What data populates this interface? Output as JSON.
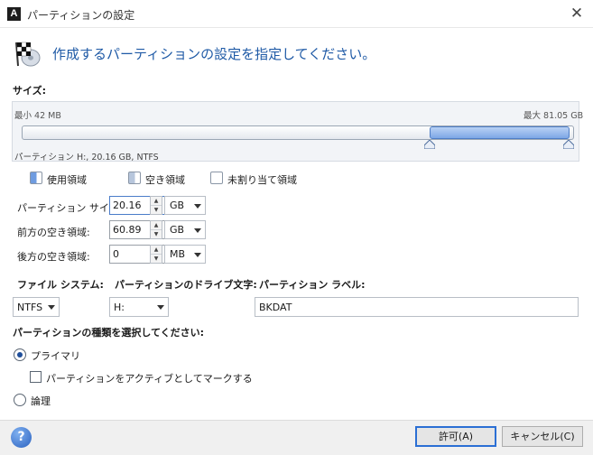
{
  "window": {
    "title": "パーティションの設定",
    "app_icon": "A",
    "close_glyph": "✕"
  },
  "header": {
    "text": "作成するパーティションの設定を指定してください。",
    "icon": "checkered-flag-disk-icon"
  },
  "size_section": {
    "label": "サイズ:",
    "min_label": "最小 42 MB",
    "max_label": "最大 81.05 GB",
    "partition_info": "パーティション H:, 20.16 GB, NTFS"
  },
  "legend": {
    "used": "使用領域",
    "free": "空き領域",
    "unallocated": "未割り当て領域"
  },
  "fields": {
    "partition_size": {
      "label": "パーティション サイズ:",
      "value": "20.16",
      "unit": "GB"
    },
    "free_before": {
      "label": "前方の空き領域:",
      "value": "60.89",
      "unit": "GB"
    },
    "free_after": {
      "label": "後方の空き領域:",
      "value": "0",
      "unit": "MB"
    }
  },
  "filesystem": {
    "label": "ファイル システム:",
    "value": "NTFS"
  },
  "drive_letter": {
    "label": "パーティションのドライブ文字:",
    "value": "H:"
  },
  "partition_label": {
    "label": "パーティション ラベル:",
    "value": "BKDAT"
  },
  "partition_type": {
    "label": "パーティションの種類を選択してください:",
    "primary": "プライマリ",
    "active_checkbox": "パーティションをアクティブとしてマークする",
    "logical": "論理",
    "selected": "primary",
    "active_checked": false
  },
  "buttons": {
    "ok": "許可(A)",
    "cancel": "キャンセル(C)",
    "help": "?"
  },
  "colors": {
    "accent": "#1f5aa6",
    "used_fill": "#7ea7e6",
    "ok_border": "#2b6fd4"
  }
}
